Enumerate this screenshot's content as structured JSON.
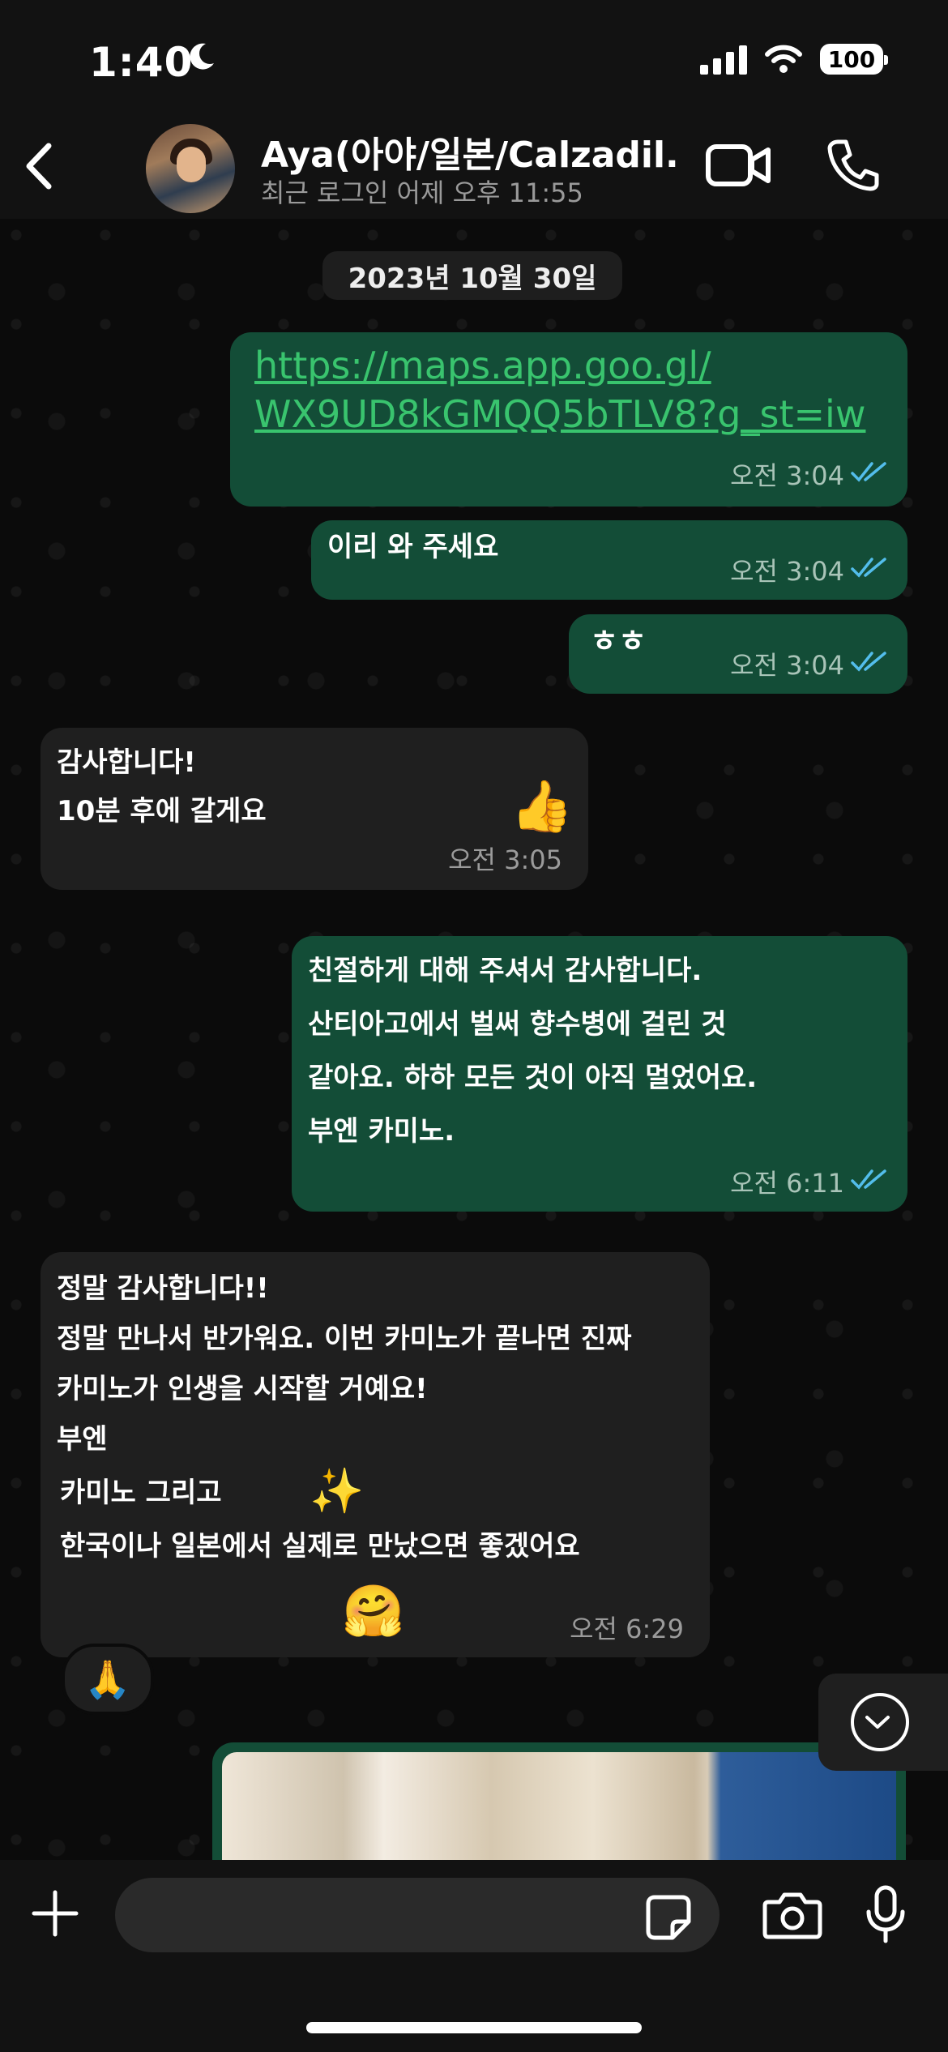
{
  "status_bar": {
    "time": "1:40",
    "battery": "100"
  },
  "header": {
    "contact_name": "Aya(아야/일본/Calzadil...",
    "contact_status": "최근 로그인 어제 오후 11:55",
    "icons": [
      "back-icon",
      "video-call-icon",
      "phone-icon"
    ]
  },
  "chat": {
    "date_separator": "2023년 10월 30일",
    "messages": [
      {
        "direction": "outgoing",
        "link_line1": "https://maps.app.goo.gl/",
        "link_line2": "WX9UD8kGMQQ5bTLV8?g_st=iw",
        "time": "오전 3:04",
        "status": "read"
      },
      {
        "direction": "outgoing",
        "text": "이리 와 주세요",
        "time": "오전 3:04",
        "status": "read"
      },
      {
        "direction": "outgoing",
        "text": "ㅎㅎ",
        "time": "오전 3:04",
        "status": "read"
      },
      {
        "direction": "incoming",
        "lines": [
          "감사합니다!",
          "10분 후에 갈게요"
        ],
        "emoji": "👍",
        "time": "오전 3:05"
      },
      {
        "direction": "outgoing",
        "lines": [
          "친절하게 대해 주셔서 감사합니다.",
          "산티아고에서 벌써 향수병에 걸린 것",
          "같아요. 하하 모든 것이 아직 멀었어요.",
          "부엔 카미노."
        ],
        "time": "오전 6:11",
        "status": "read"
      },
      {
        "direction": "incoming",
        "lines": [
          "정말 감사합니다!!",
          "정말 만나서 반가워요. 이번 카미노가 끝나면 진짜",
          "카미노가 인생을 시작할 거예요!",
          "부엔",
          "카미노 그리고",
          "한국이나 일본에서 실제로 만났으면 좋겠어요"
        ],
        "emoji_sparkles": "✨",
        "emoji_hug": "🤗",
        "time": "오전 6:29",
        "reaction": "🙏"
      }
    ]
  },
  "composer": {
    "placeholder": ""
  },
  "colors": {
    "outgoing_bubble": "#134d37",
    "incoming_bubble": "#1f1f1f",
    "read_ticks": "#53bdeb",
    "link": "#39c46e"
  }
}
